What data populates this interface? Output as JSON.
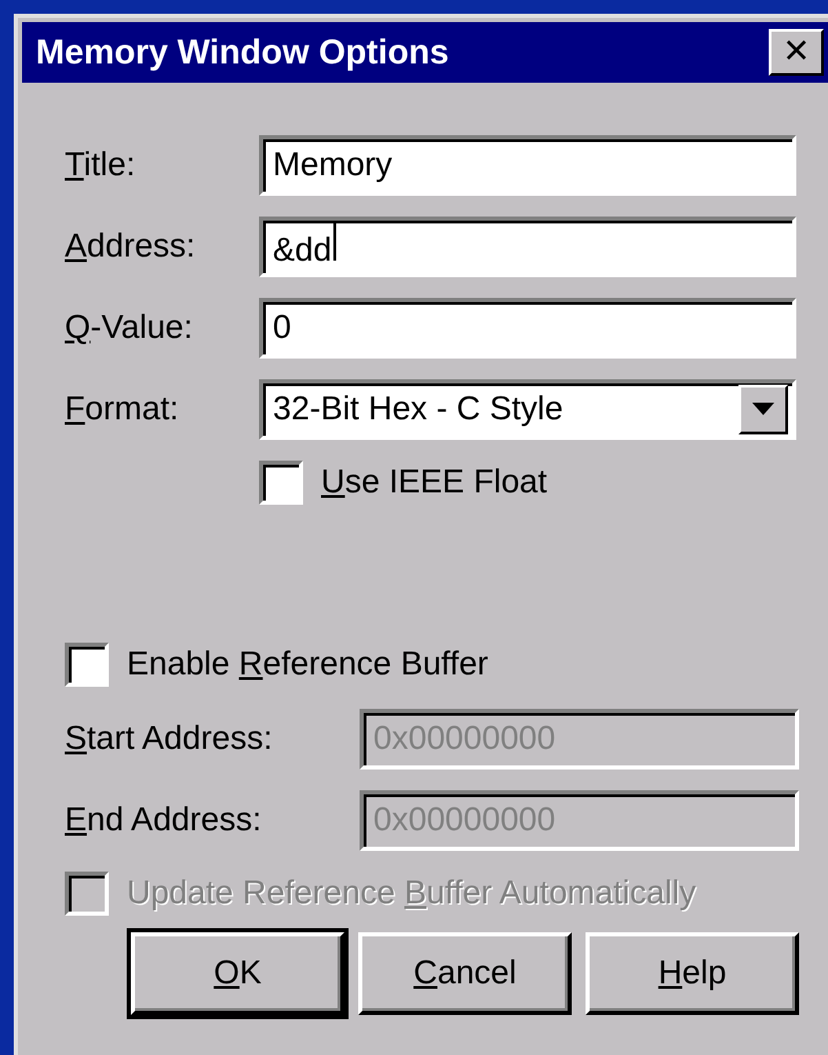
{
  "window": {
    "title": "Memory Window Options",
    "close_label": "✕"
  },
  "fields": [
    {
      "key": "T",
      "after": "itle:",
      "value": "Memory",
      "focused": false
    },
    {
      "key": "A",
      "after": "ddress:",
      "value": "&dd",
      "focused": true
    },
    {
      "key": "Q",
      "after": "-Value:",
      "value": "0",
      "focused": false
    }
  ],
  "format": {
    "key": "F",
    "after": "ormat:",
    "value": "32-Bit Hex - C Style"
  },
  "ieee": {
    "key": "U",
    "after": "se IEEE Float",
    "checked": false,
    "disabled": false
  },
  "reference": {
    "before": "Enable ",
    "key": "R",
    "after": "eference Buffer",
    "checked": false,
    "disabled": false
  },
  "range_fields": [
    {
      "key": "S",
      "after": "tart Address:",
      "value": "0x00000000",
      "disabled": true
    },
    {
      "key": "E",
      "after": "nd Address:",
      "value": "0x00000000",
      "disabled": true
    }
  ],
  "auto_update": {
    "before": "Update Reference ",
    "key": "B",
    "after": "uffer Automatically",
    "checked": false,
    "disabled": true
  },
  "buttons": [
    {
      "key": "O",
      "after": "K",
      "default": true
    },
    {
      "key": "C",
      "after": "ancel",
      "default": false
    },
    {
      "key": "H",
      "after": "elp",
      "default": false
    }
  ]
}
